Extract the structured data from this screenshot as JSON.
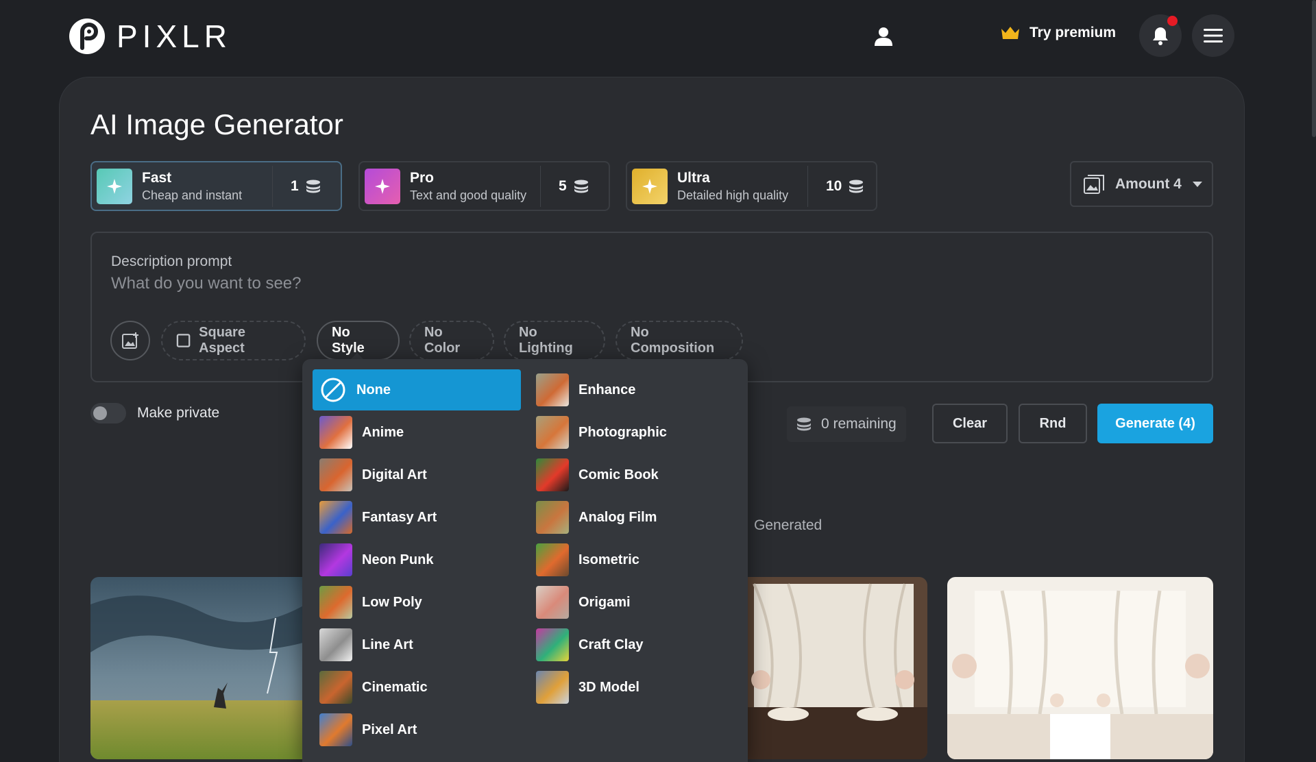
{
  "brand": {
    "name": "PIXLR"
  },
  "header": {
    "premium_label": "Try premium"
  },
  "page": {
    "title": "AI Image Generator"
  },
  "tiers": [
    {
      "name": "Fast",
      "desc": "Cheap and instant",
      "cost": "1",
      "color": "#4fc3b0",
      "selected": true
    },
    {
      "name": "Pro",
      "desc": "Text and good quality",
      "cost": "5",
      "color": "#c44fd6",
      "selected": false
    },
    {
      "name": "Ultra",
      "desc": "Detailed high quality",
      "cost": "10",
      "color": "#e2b82f",
      "selected": false
    }
  ],
  "amount": {
    "label": "Amount 4"
  },
  "prompt": {
    "label": "Description prompt",
    "placeholder": "What do you want to see?"
  },
  "chips": {
    "aspect": "Square Aspect",
    "style": "No Style",
    "color": "No Color",
    "lighting": "No Lighting",
    "composition": "No Composition"
  },
  "options": {
    "private_label": "Make private"
  },
  "actions": {
    "remaining": "0 remaining",
    "clear": "Clear",
    "rnd": "Rnd",
    "generate": "Generate (4)"
  },
  "tabs": {
    "generated": "Generated"
  },
  "style_menu": {
    "left": [
      "None",
      "Anime",
      "Digital Art",
      "Fantasy Art",
      "Neon Punk",
      "Low Poly",
      "Line Art",
      "Cinematic",
      "Pixel Art"
    ],
    "right": [
      "Enhance",
      "Photographic",
      "Comic Book",
      "Analog Film",
      "Isometric",
      "Origami",
      "Craft Clay",
      "3D Model"
    ],
    "selected": "None"
  },
  "colors": {
    "accent": "#1aa3e0",
    "notification": "#e61b25",
    "crown": "#f2b51b"
  }
}
